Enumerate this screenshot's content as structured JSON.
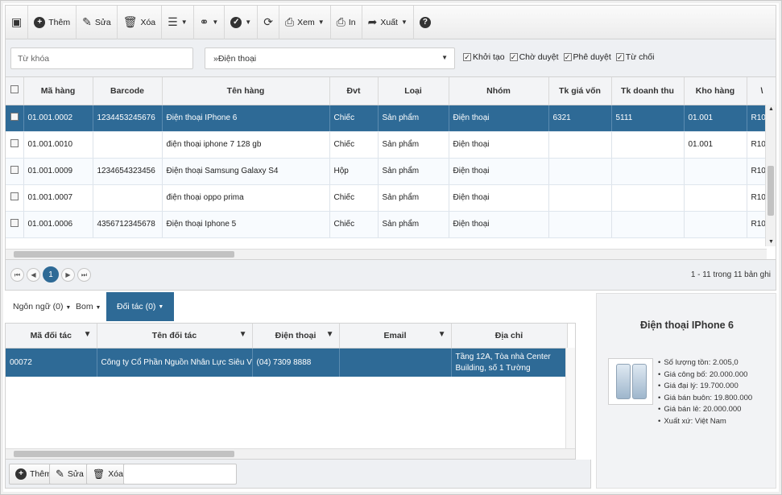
{
  "toolbar": {
    "binoculars_icon": "binoculars",
    "add_label": "Thêm",
    "edit_label": "Sửa",
    "delete_label": "Xóa",
    "view_label": "Xem",
    "print_label": "In",
    "export_label": "Xuất"
  },
  "filter": {
    "keyword_placeholder": "Từ khóa",
    "group_value": "»Điện thoại",
    "status_checks": [
      {
        "label": "Khởi tạo",
        "checked": true
      },
      {
        "label": "Chờ duyệt",
        "checked": true
      },
      {
        "label": "Phê duyệt",
        "checked": true
      },
      {
        "label": "Từ chối",
        "checked": true
      }
    ]
  },
  "grid": {
    "columns": [
      "Mã hàng",
      "Barcode",
      "Tên hàng",
      "Đvt",
      "Loại",
      "Nhóm",
      "Tk giá vốn",
      "Tk doanh thu",
      "Kho hàng",
      "\\"
    ],
    "rows": [
      {
        "code": "01.001.0002",
        "barcode": "1234453245676",
        "name": "Điện thoại IPhone 6",
        "unit": "Chiếc",
        "type": "Sản phẩm",
        "group": "Điện thoại",
        "cogs": "6321",
        "revenue": "5111",
        "warehouse": "01.001",
        "extra": "R10",
        "selected": true
      },
      {
        "code": "01.001.0010",
        "barcode": "",
        "name": "điện thoại iphone 7 128 gb",
        "unit": "Chiếc",
        "type": "Sản phẩm",
        "group": "Điện thoại",
        "cogs": "",
        "revenue": "",
        "warehouse": "01.001",
        "extra": "R10",
        "selected": false
      },
      {
        "code": "01.001.0009",
        "barcode": "1234654323456",
        "name": "Điện thoại Samsung Galaxy S4",
        "unit": "Hộp",
        "type": "Sản phẩm",
        "group": "Điện thoại",
        "cogs": "",
        "revenue": "",
        "warehouse": "",
        "extra": "R10",
        "selected": false
      },
      {
        "code": "01.001.0007",
        "barcode": "",
        "name": "điện thoại oppo prima",
        "unit": "Chiếc",
        "type": "Sản phẩm",
        "group": "Điện thoại",
        "cogs": "",
        "revenue": "",
        "warehouse": "",
        "extra": "R10",
        "selected": false
      },
      {
        "code": "01.001.0006",
        "barcode": "4356712345678",
        "name": "Điện thoại Iphone 5",
        "unit": "Chiếc",
        "type": "Sản phẩm",
        "group": "Điện thoại",
        "cogs": "",
        "revenue": "",
        "warehouse": "",
        "extra": "R10",
        "selected": false
      }
    ]
  },
  "pager": {
    "current_page": "1",
    "info": "1 - 11 trong 11 bản ghi"
  },
  "subtabs": {
    "language": "Ngôn ngữ (0)",
    "bom": "Bom",
    "partner": "Đối tác (0)"
  },
  "partner_grid": {
    "columns": [
      "Mã đối tác",
      "Tên đối tác",
      "Điện thoại",
      "Email",
      "Địa chỉ"
    ],
    "row": {
      "code": "00072",
      "name": "Công ty Cổ Phần Nguồn Nhân Lực Siêu Việt",
      "phone": "(04) 7309 8888",
      "email": "",
      "address": "Tầng 12A, Tòa nhà Center Building, số 1 Tường"
    }
  },
  "sub_actions": {
    "add_label": "Thêm",
    "edit_label": "Sửa",
    "delete_label": "Xóa"
  },
  "detail": {
    "title": "Điện thoại IPhone 6",
    "facts": [
      "Số lượng tồn: 2.005,0",
      "Giá công bố: 20.000.000",
      "Giá đại lý: 19.700.000",
      "Giá bán buôn: 19.800.000",
      "Giá bán lẻ: 20.000.000",
      "Xuất xứ: Việt Nam"
    ]
  },
  "colors": {
    "accent": "#2e6a96",
    "toolbar_bg": "#ececec",
    "panel_bg": "#eef0f3"
  }
}
